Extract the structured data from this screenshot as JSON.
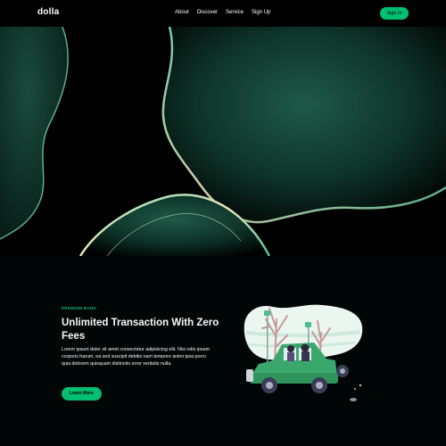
{
  "nav": {
    "logo": "dolla",
    "links": [
      "About",
      "Discover",
      "Service",
      "Sign Up"
    ],
    "signin": "Sign In"
  },
  "info": {
    "topline": "PREMIUM BANK",
    "heading": "Unlimited Transaction With Zero Fees",
    "description": "Lorem ipsum dolor sit amet consectetur adipisicing elit. Nisi odio ipsam corporis harum, ea sed suscipit debitis nam tempore animi ipsa porro quia dolorem quisquam distinctio error veritatis nulla.",
    "button": "Learn More"
  },
  "colors": {
    "accent": "#01bf71",
    "background": "#010606"
  }
}
